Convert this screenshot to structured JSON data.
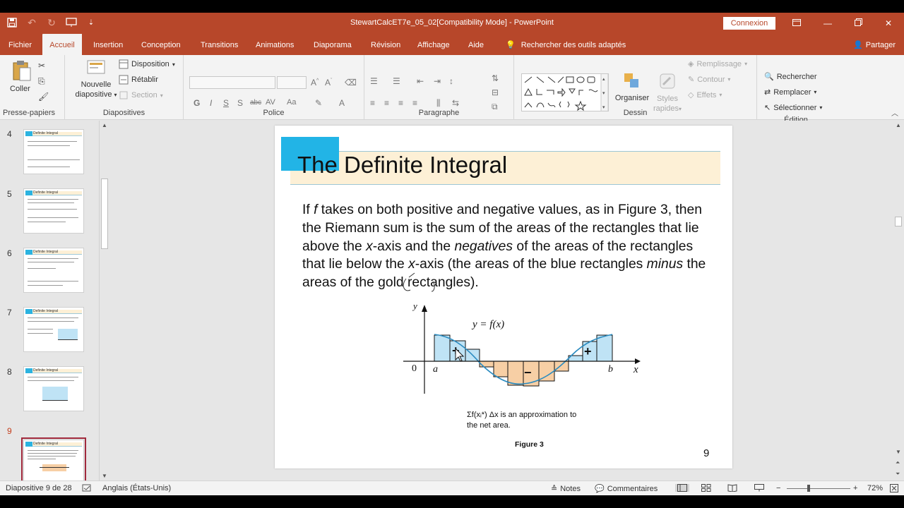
{
  "window": {
    "title": "StewartCalcET7e_05_02[Compatibility Mode]  -  PowerPoint",
    "connexion_label": "Connexion"
  },
  "menu": {
    "tabs": [
      "Fichier",
      "Accueil",
      "Insertion",
      "Conception",
      "Transitions",
      "Animations",
      "Diaporama",
      "Révision",
      "Affichage",
      "Aide"
    ],
    "active_tab": "Accueil",
    "tell_me": "Rechercher des outils adaptés",
    "share": "Partager"
  },
  "ribbon": {
    "clipboard": {
      "label": "Presse-papiers",
      "paste": "Coller"
    },
    "slides": {
      "label": "Diapositives",
      "new_slide_1": "Nouvelle",
      "new_slide_2": "diapositive",
      "layout": "Disposition",
      "reset": "Rétablir",
      "section": "Section"
    },
    "font": {
      "label": "Police",
      "bold": "G",
      "italic": "I",
      "underline": "S",
      "shadow": "S",
      "strike": "abc",
      "spacing": "AV",
      "case": "Aa",
      "color": "A"
    },
    "paragraph": {
      "label": "Paragraphe"
    },
    "drawing": {
      "label": "Dessin",
      "arrange": "Organiser",
      "quick_styles_1": "Styles",
      "quick_styles_2": "rapides",
      "fill": "Remplissage",
      "outline": "Contour",
      "effects": "Effets"
    },
    "editing": {
      "label": "Édition",
      "find": "Rechercher",
      "replace": "Remplacer",
      "select": "Sélectionner"
    }
  },
  "thumbnails": {
    "numbers": [
      "4",
      "5",
      "6",
      "7",
      "8",
      "9"
    ],
    "title": "Definite Integral",
    "selected": "9"
  },
  "slide": {
    "title": "The Definite Integral",
    "body": {
      "t1": "If ",
      "f": "f",
      "t2": " takes on both positive and negative values, as in Figure 3, then the Riemann sum is the sum of the areas of the rectangles that lie above the ",
      "x1": "x",
      "t3": "-axis and the ",
      "negatives": "negatives",
      "t4": " of the areas of the rectangles that lie below the ",
      "x2": "x",
      "t5": "-axis (the areas of the blue rectangles ",
      "minus": "minus",
      "t6": " the areas of the gold rectangles)."
    },
    "figure": {
      "y_axis": "y",
      "x_axis": "x",
      "curve_label": "y = f(x)",
      "origin": "0",
      "a": "a",
      "b": "b",
      "plus": "+",
      "minus": "−"
    },
    "caption_1": "Σf(xᵢ*) Δx is an approximation to",
    "caption_2": "the net area.",
    "figure_label": "Figure 3",
    "page_number": "9"
  },
  "status": {
    "slide_of": "Diapositive 9 de 28",
    "language": "Anglais (États-Unis)",
    "notes": "Notes",
    "comments": "Commentaires",
    "zoom": "72%"
  },
  "colors": {
    "accent": "#b7472a",
    "title_square": "#22b4e6",
    "title_band": "#fdf0d6",
    "blue_rect": "#bfe3f5",
    "gold_rect": "#f7cfa5"
  }
}
